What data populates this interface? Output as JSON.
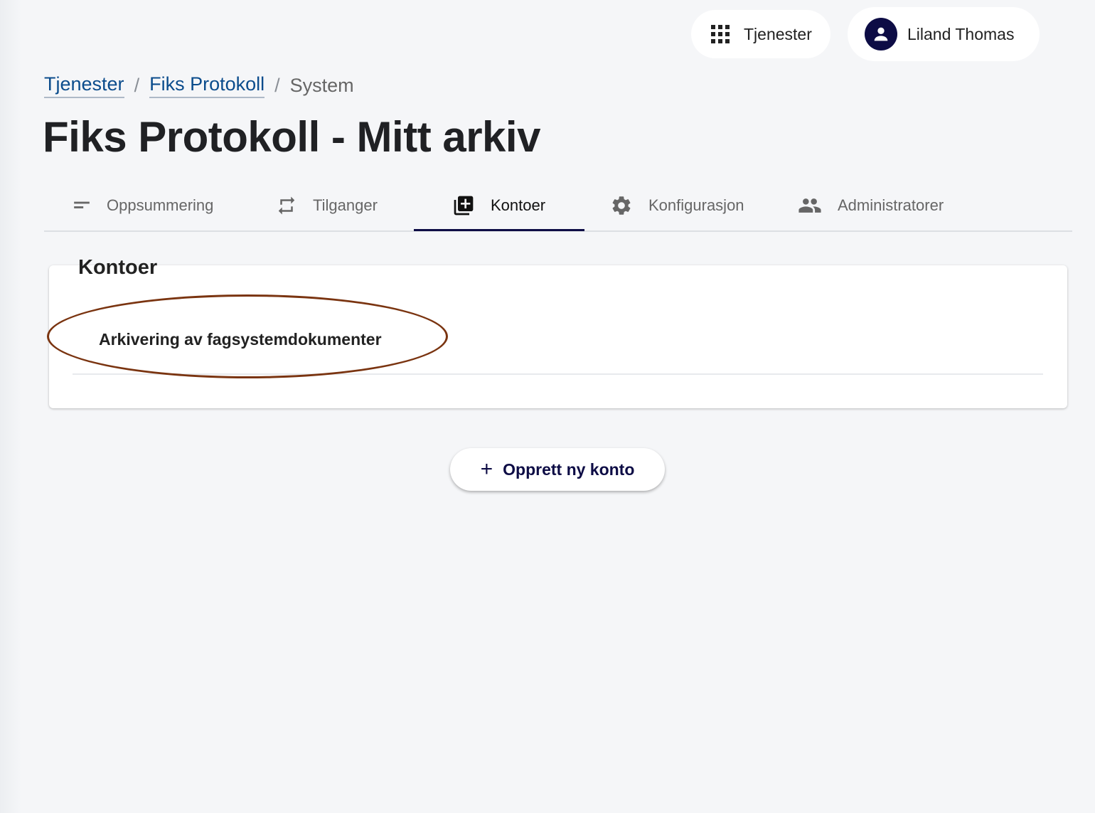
{
  "header": {
    "services_label": "Tjenester",
    "user_name": "Liland Thomas"
  },
  "breadcrumb": {
    "items": [
      "Tjenester",
      "Fiks Protokoll"
    ],
    "current": "System",
    "separator": "/"
  },
  "page": {
    "title": "Fiks Protokoll - Mitt arkiv"
  },
  "tabs": [
    {
      "label": "Oppsummering",
      "icon": "short-text-icon"
    },
    {
      "label": "Tilganger",
      "icon": "repeat-icon"
    },
    {
      "label": "Kontoer",
      "icon": "library-add-icon",
      "active": true
    },
    {
      "label": "Konfigurasjon",
      "icon": "gear-icon"
    },
    {
      "label": "Administratorer",
      "icon": "people-icon"
    }
  ],
  "accounts": {
    "title": "Kontoer",
    "items": [
      "Arkivering av fagsystemdokumenter"
    ]
  },
  "actions": {
    "create_label": "Opprett ny konto"
  },
  "colors": {
    "accent": "#0d0c45",
    "link": "#0b4c8c",
    "highlight": "#7a3410"
  }
}
